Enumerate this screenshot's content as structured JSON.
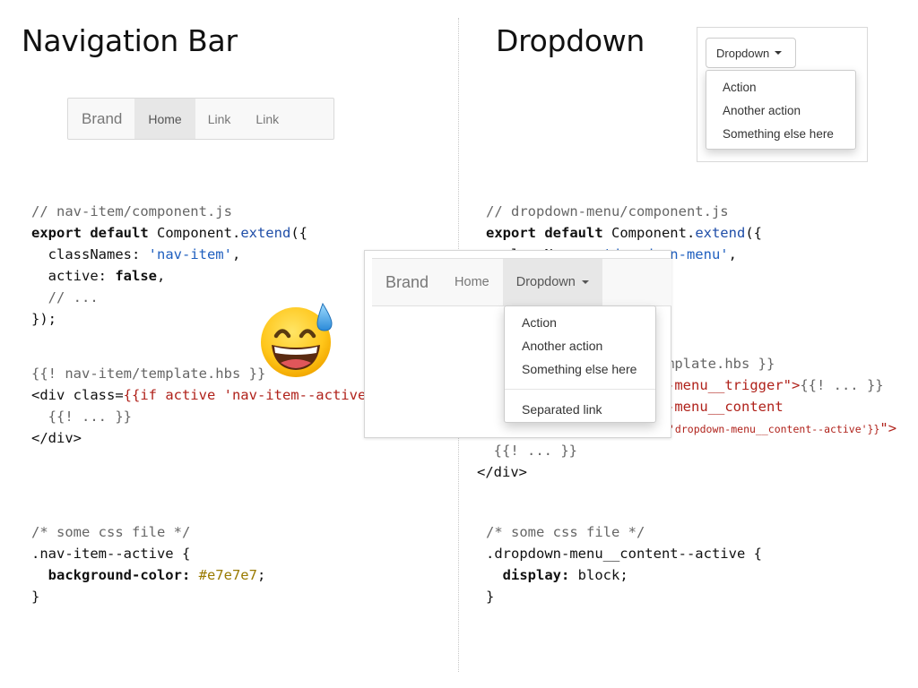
{
  "titles": {
    "left": "Navigation Bar",
    "right": "Dropdown"
  },
  "navbar_small": {
    "brand": "Brand",
    "items": [
      "Home",
      "Link",
      "Link"
    ],
    "active_index": 0
  },
  "dropdown_demo": {
    "toggle_label": "Dropdown",
    "items": [
      "Action",
      "Another action",
      "Something else here"
    ]
  },
  "navbar_big": {
    "brand": "Brand",
    "items": [
      "Home",
      "Dropdown"
    ],
    "open_index": 1,
    "menu_items": [
      "Action",
      "Another action",
      "Something else here"
    ],
    "separated_item": "Separated link"
  },
  "code_left": {
    "js": {
      "comment": "// nav-item/component.js",
      "export_kw": "export default",
      "class_ref": " Component.",
      "extend_fn": "extend",
      "extend_open": "({",
      "classnames_key": "  classNames: ",
      "classnames_val": "'nav-item'",
      "classnames_end": ",",
      "active_key": "  active: ",
      "active_val": "false",
      "active_end": ",",
      "ellipsis": "  // ...",
      "close": "});"
    },
    "hbs": {
      "comment": "{{! nav-item/template.hbs }}",
      "div_open_a": "<div class=",
      "div_open_b": "{{if active 'nav-item--active'}}",
      "div_open_c": ">",
      "inner": "  {{! ... }}",
      "div_close": "</div>"
    },
    "css": {
      "comment": "/* some css file */",
      "selector": ".nav-item--active {",
      "prop": "  background-color: ",
      "val": "#e7e7e7",
      "semi": ";",
      "close": "}"
    }
  },
  "code_right": {
    "js": {
      "comment": "// dropdown-menu/component.js",
      "export_kw": "export default",
      "class_ref": " Component.",
      "extend_fn": "extend",
      "extend_open": "({",
      "classnames_key": "  classNames: ",
      "classnames_val": "'dropdown-menu'",
      "classnames_end": ","
    },
    "hbs": {
      "comment_tail": "mplate.hbs }}",
      "trigger_tail": "-menu__trigger\">",
      "trigger_after": "{{! ... }}",
      "content_tail": "-menu__content",
      "content_cond": "'dropdown-menu__content--active'}}",
      "content_end": "\">",
      "inner": "  {{! ... }}",
      "div_close": "</div>"
    },
    "css": {
      "comment": "/* some css file */",
      "selector": ".dropdown-menu__content--active {",
      "prop": "  display: ",
      "val": "block",
      "semi": ";",
      "close": "}"
    }
  },
  "emoji": {
    "icon": "grinning-face-with-sweat-icon"
  }
}
